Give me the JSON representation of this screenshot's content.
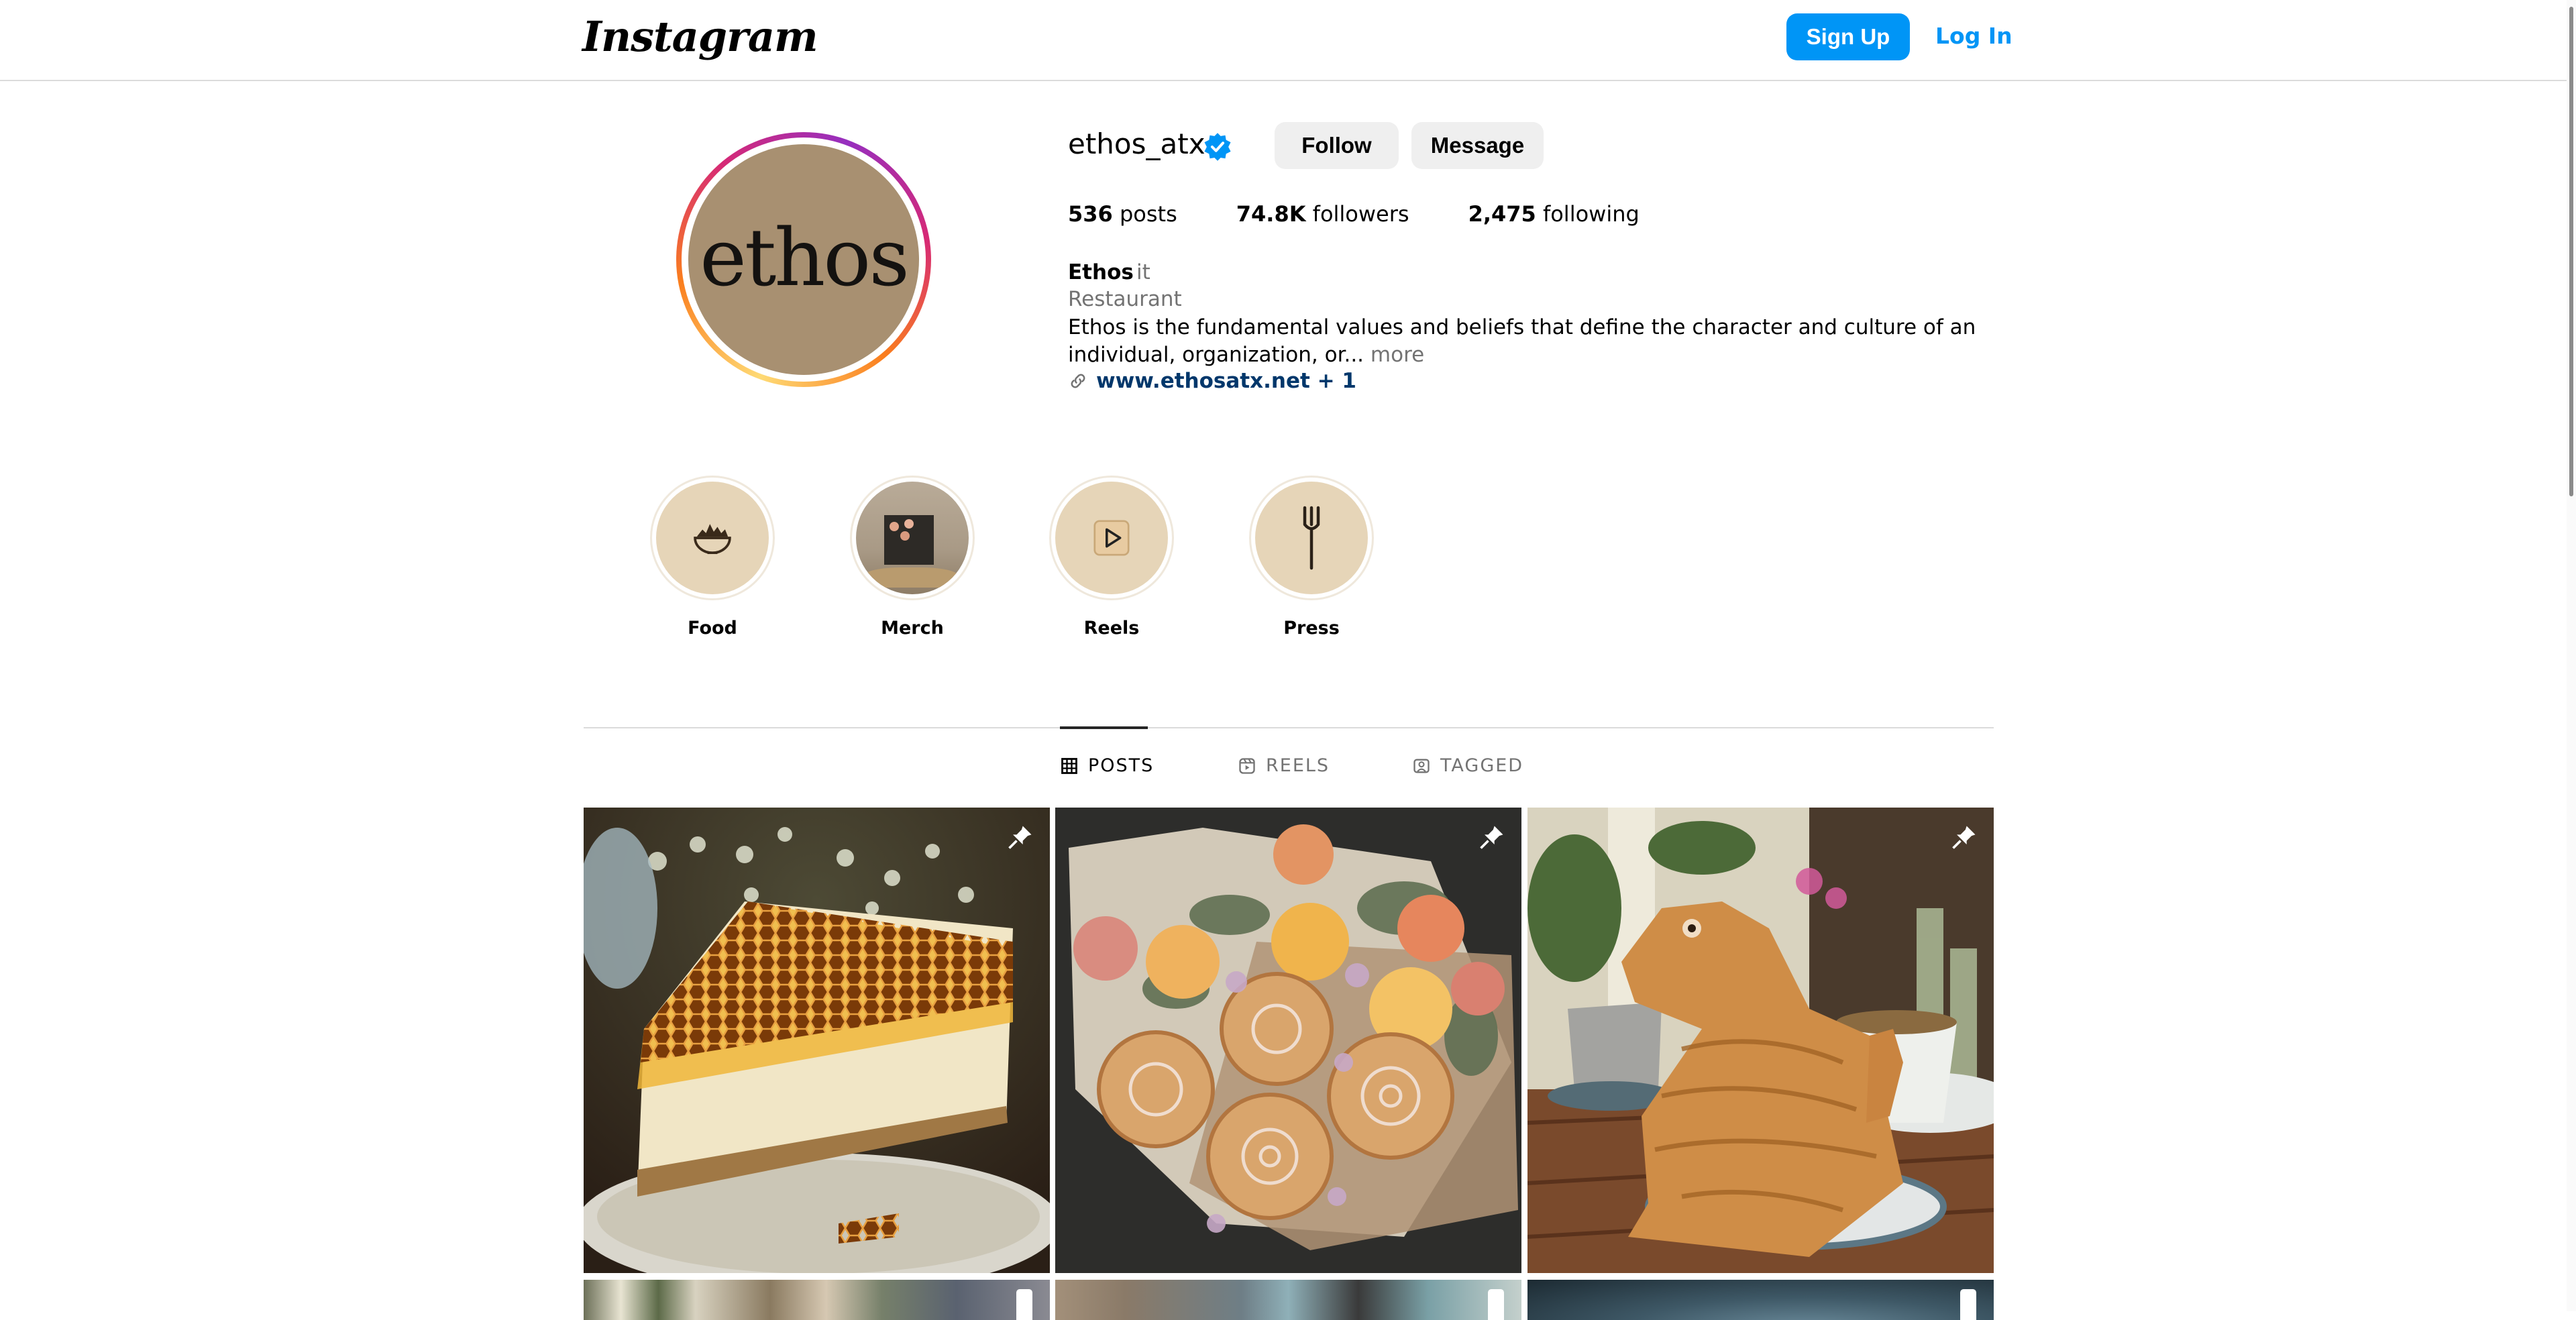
{
  "header": {
    "logo": "Instagram",
    "signup_label": "Sign Up",
    "login_label": "Log In",
    "accent_color": "#0095f6"
  },
  "profile": {
    "avatar_text": "ethos",
    "username": "ethos_atx",
    "verified": true,
    "follow_label": "Follow",
    "message_label": "Message",
    "stats": [
      {
        "value": "536",
        "label": "posts"
      },
      {
        "value": "74.8K",
        "label": "followers"
      },
      {
        "value": "2,475",
        "label": "following"
      }
    ],
    "full_name": "Ethos",
    "pronoun": "it",
    "category": "Restaurant",
    "bio": "Ethos is the fundamental values and beliefs that define the character and culture of an individual, organization, or...",
    "bio_more": "more",
    "link_text": "www.ethosatx.net + 1",
    "link_icon": "link-icon"
  },
  "highlights": [
    {
      "label": "Food",
      "icon": "bowl-icon"
    },
    {
      "label": "Merch",
      "icon": "merch-photo"
    },
    {
      "label": "Reels",
      "icon": "play-icon"
    },
    {
      "label": "Press",
      "icon": "fork-icon"
    }
  ],
  "tabs": [
    {
      "label": "POSTS",
      "icon": "grid-icon",
      "active": true
    },
    {
      "label": "REELS",
      "icon": "reels-icon",
      "active": false
    },
    {
      "label": "TAGGED",
      "icon": "tagged-icon",
      "active": false
    }
  ],
  "posts": [
    {
      "subject": "Honeycomb cheesecake slice",
      "pinned": true
    },
    {
      "subject": "Cinnamon roll and rose bouquet",
      "pinned": true
    },
    {
      "subject": "Croissant dinosaur with teacup",
      "pinned": true
    },
    {
      "subject": "Post",
      "pinned": false
    },
    {
      "subject": "Post",
      "pinned": false
    },
    {
      "subject": "Post",
      "pinned": false
    }
  ]
}
